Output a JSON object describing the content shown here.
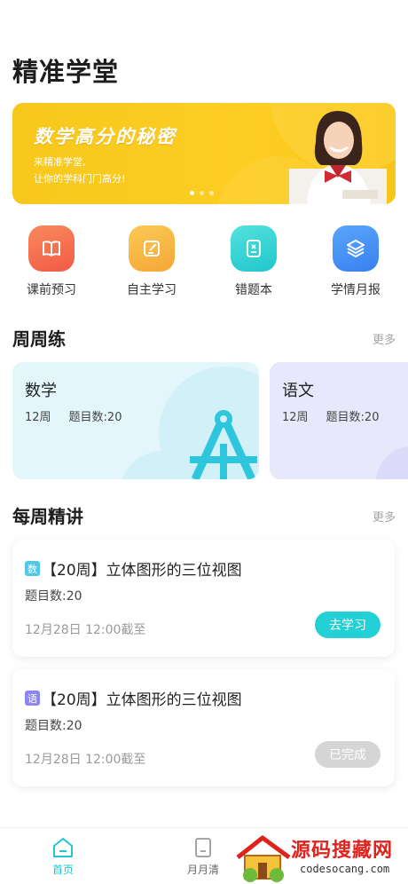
{
  "app": {
    "title": "精准学堂"
  },
  "banner": {
    "headline": "数学高分的秘密",
    "sub_line1": "来精准学堂,",
    "sub_line2": "让你的学科门门高分!",
    "page_count": 3,
    "active_page": 1
  },
  "quick_entries": [
    {
      "label": "课前预习",
      "icon": "book-icon",
      "color": "#f4694c"
    },
    {
      "label": "自主学习",
      "icon": "edit-icon",
      "color": "#f8b53f"
    },
    {
      "label": "错题本",
      "icon": "mistake-book-icon",
      "color": "#2fd3d3"
    },
    {
      "label": "学情月报",
      "icon": "layers-icon",
      "color": "#3f8ef5"
    }
  ],
  "weekly": {
    "title": "周周练",
    "more": "更多",
    "cards": [
      {
        "subject": "数学",
        "week": "12周",
        "count_label": "题目数:20"
      },
      {
        "subject": "语文",
        "week": "12周",
        "count_label": "题目数:20"
      }
    ]
  },
  "lectures": {
    "title": "每周精讲",
    "more": "更多",
    "items": [
      {
        "tag": "数",
        "tag_color": "#52c8e8",
        "title": "【20周】立体图形的三位视图",
        "count": "题目数:20",
        "deadline": "12月28日 12:00截至",
        "button": "去学习"
      },
      {
        "tag": "语",
        "tag_color": "#8e86f0",
        "title": "【20周】立体图形的三位视图",
        "count": "题目数:20",
        "deadline": "12月28日 12:00截至",
        "button": "已完成"
      }
    ]
  },
  "tabbar": {
    "active_color": "#22c6cf",
    "tabs": [
      {
        "label": "首页",
        "icon": "home-icon"
      },
      {
        "label": "月月清",
        "icon": "calendar-icon"
      }
    ]
  },
  "watermark": {
    "text": "源码搜藏网",
    "url": "codesocang.com"
  }
}
